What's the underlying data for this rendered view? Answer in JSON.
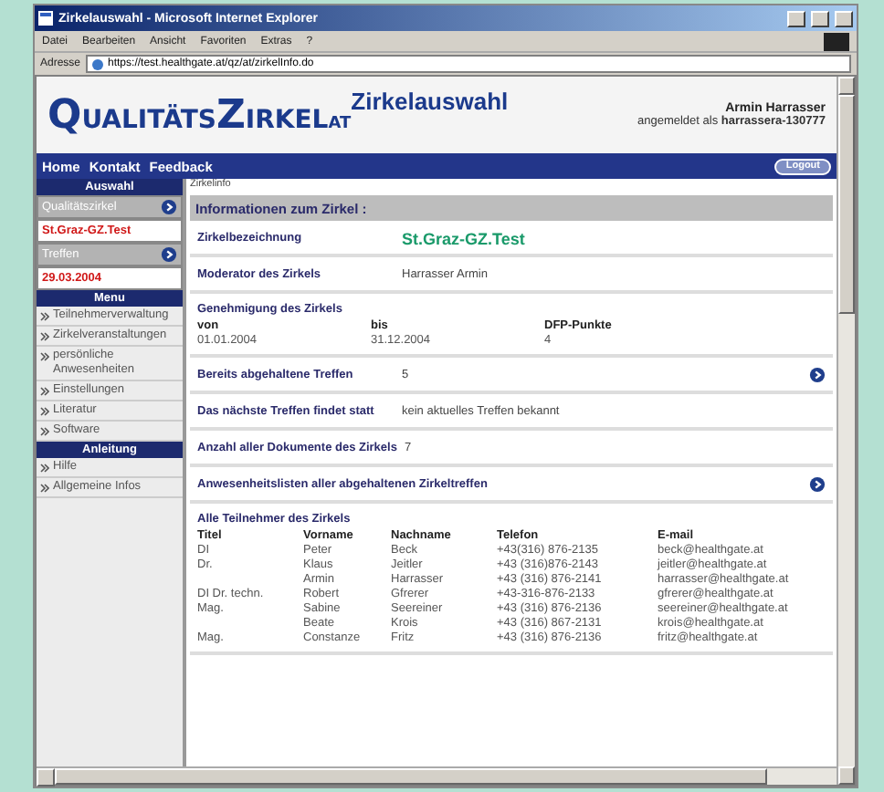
{
  "window": {
    "title": "Zirkelauswahl - Microsoft Internet Explorer",
    "menu": [
      "Datei",
      "Bearbeiten",
      "Ansicht",
      "Favoriten",
      "Extras",
      "?"
    ],
    "address_label": "Adresse",
    "url": "https://test.healthgate.at/qz/at/zirkelInfo.do"
  },
  "header": {
    "logo": [
      {
        "text": "Q",
        "kind": "initial"
      },
      {
        "text": "UALITÄTS",
        "kind": "rest"
      },
      {
        "text": "Z",
        "kind": "initial"
      },
      {
        "text": "IRKEL",
        "kind": "rest"
      },
      {
        "text": "AT",
        "kind": "suffix"
      }
    ],
    "page_title": "Zirkelauswahl",
    "user": "Armin Harrasser",
    "login": "angemeldet als **harrassera-130777**"
  },
  "nav": {
    "links": [
      "Home",
      "Kontakt",
      "Feedback"
    ],
    "logout": "Logout"
  },
  "sidebar": [
    {
      "title": "Auswahl",
      "items": [
        {
          "kind": "selector",
          "label": "Qualitätszirkel"
        },
        {
          "kind": "value",
          "label": "St.Graz-GZ.Test"
        },
        {
          "kind": "selector",
          "label": "Treffen"
        },
        {
          "kind": "value",
          "label": "29.03.2004"
        }
      ]
    },
    {
      "title": "Menu",
      "items": [
        {
          "kind": "link",
          "label": "Teilnehmerverwaltung"
        },
        {
          "kind": "link",
          "label": "Zirkelveranstaltungen"
        },
        {
          "kind": "link",
          "label": "persönliche Anwesenheiten"
        },
        {
          "kind": "link",
          "label": "Einstellungen"
        },
        {
          "kind": "link",
          "label": "Literatur"
        },
        {
          "kind": "link",
          "label": "Software"
        }
      ]
    },
    {
      "title": "Anleitung",
      "items": [
        {
          "kind": "link",
          "label": "Hilfe"
        },
        {
          "kind": "link",
          "label": "Allgemeine Infos"
        }
      ]
    }
  ],
  "breadcrumb": "Zirkelinfo",
  "section_title": "Informationen zum Zirkel :",
  "rows": [
    {
      "kind": "pair",
      "label": "Zirkelbezeichnung",
      "value": "St.Graz-GZ.Test",
      "highlight": true,
      "link": false
    },
    {
      "kind": "pair",
      "label": "Moderator des Zirkels",
      "value": "Harrasser Armin",
      "highlight": false,
      "link": false
    },
    {
      "kind": "approval",
      "label": "Genehmigung des Zirkels",
      "columns": [
        {
          "heading": "von",
          "value": "01.01.2004"
        },
        {
          "heading": "bis",
          "value": "31.12.2004"
        },
        {
          "heading": "DFP-Punkte",
          "value": "4"
        }
      ]
    },
    {
      "kind": "pair",
      "label": "Bereits abgehaltene Treffen",
      "value": "5",
      "highlight": false,
      "link": true
    },
    {
      "kind": "pair",
      "label": "Das nächste Treffen findet statt",
      "value": "kein aktuelles Treffen bekannt",
      "highlight": false,
      "link": false
    },
    {
      "kind": "pair",
      "label": "Anzahl aller Dokumente des Zirkels",
      "value": "7",
      "highlight": false,
      "link": false
    },
    {
      "kind": "pair",
      "label": "Anwesenheitslisten aller abgehaltenen Zirkeltreffen",
      "highlight": false,
      "link": true
    }
  ],
  "participants": {
    "title": "Alle Teilnehmer des Zirkels",
    "columns": [
      "Titel",
      "Vorname",
      "Nachname",
      "Telefon",
      "E-mail"
    ],
    "rows": [
      [
        "DI",
        "Peter",
        "Beck",
        "+43(316) 876-2135",
        "beck@healthgate.at"
      ],
      [
        "Dr.",
        "Klaus",
        "Jeitler",
        "+43 (316)876-2143",
        "jeitler@healthgate.at"
      ],
      [
        "",
        "Armin",
        "Harrasser",
        "+43 (316) 876-2141",
        "harrasser@healthgate.at"
      ],
      [
        "DI Dr. techn.",
        "Robert",
        "Gfrerer",
        "+43-316-876-2133",
        "gfrerer@healthgate.at"
      ],
      [
        "Mag.",
        "Sabine",
        "Seereiner",
        "+43 (316) 876-2136",
        "seereiner@healthgate.at"
      ],
      [
        "",
        "Beate",
        "Krois",
        "+43 (316) 867-2131",
        "krois@healthgate.at"
      ],
      [
        "Mag.",
        "Constanze",
        "Fritz",
        "+43 (316) 876-2136",
        "fritz@healthgate.at"
      ]
    ]
  }
}
